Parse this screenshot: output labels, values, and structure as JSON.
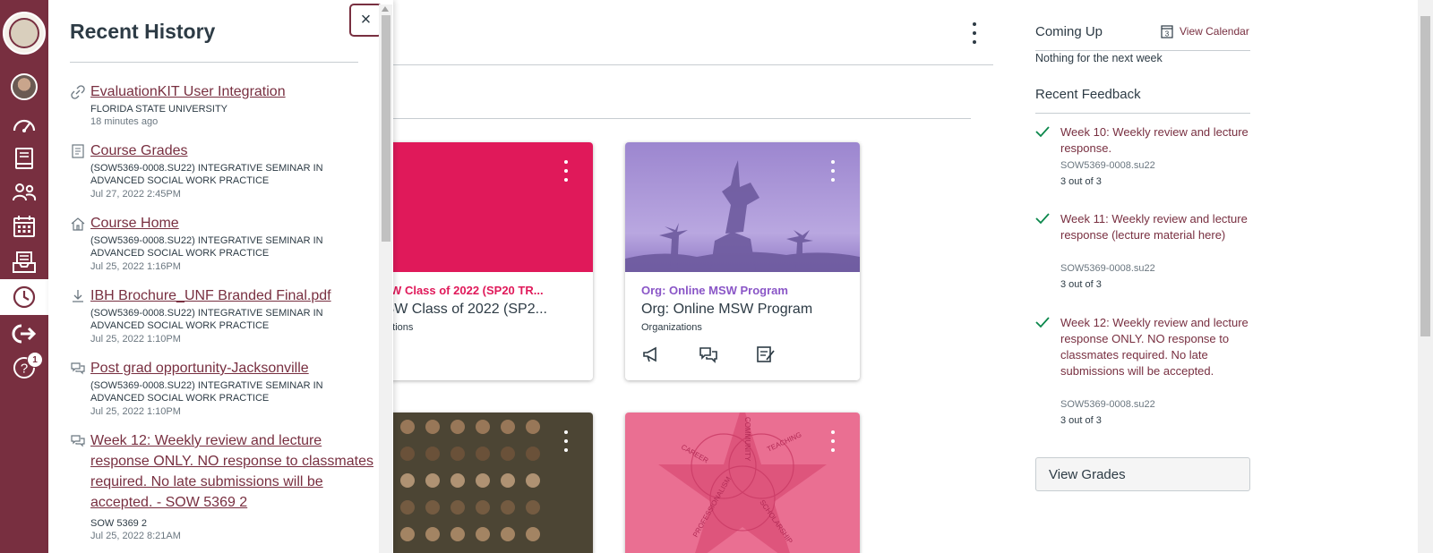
{
  "colors": {
    "brand": "#782f40",
    "card_pink": "#e0195a",
    "card_purple": "#a98fd6",
    "card_link_purple": "#8a56c7",
    "check_green": "#0b874b"
  },
  "nav": {
    "items": [
      {
        "name": "logo",
        "icon": "university-seal"
      },
      {
        "name": "account",
        "icon": "avatar"
      },
      {
        "name": "dashboard",
        "icon": "dashboard-icon"
      },
      {
        "name": "courses",
        "icon": "book-icon"
      },
      {
        "name": "groups",
        "icon": "groups-icon"
      },
      {
        "name": "calendar",
        "icon": "calendar-icon"
      },
      {
        "name": "inbox",
        "icon": "inbox-icon"
      },
      {
        "name": "history",
        "icon": "clock-icon",
        "active": true
      },
      {
        "name": "logout",
        "icon": "logout-icon"
      },
      {
        "name": "help",
        "icon": "help-icon"
      }
    ],
    "help_badge": "1"
  },
  "tray": {
    "title": "Recent History",
    "close_label": "×",
    "items": [
      {
        "icon": "link-icon",
        "title": "EvaluationKIT User Integration",
        "context": "FLORIDA STATE UNIVERSITY",
        "time": "18 minutes ago"
      },
      {
        "icon": "grades-icon",
        "title": "Course Grades",
        "context": "(SOW5369-0008.SU22) INTEGRATIVE SEMINAR IN ADVANCED SOCIAL WORK PRACTICE",
        "time": "Jul 27, 2022 2:45PM"
      },
      {
        "icon": "home-icon",
        "title": "Course Home",
        "context": "(SOW5369-0008.SU22) INTEGRATIVE SEMINAR IN ADVANCED SOCIAL WORK PRACTICE",
        "time": "Jul 25, 2022 1:16PM"
      },
      {
        "icon": "download-icon",
        "title": "IBH Brochure_UNF Branded Final.pdf",
        "context": "(SOW5369-0008.SU22) INTEGRATIVE SEMINAR IN ADVANCED SOCIAL WORK PRACTICE",
        "time": "Jul 25, 2022 1:10PM"
      },
      {
        "icon": "discussion-icon",
        "title": "Post grad opportunity-Jacksonville",
        "context": "(SOW5369-0008.SU22) INTEGRATIVE SEMINAR IN ADVANCED SOCIAL WORK PRACTICE",
        "time": "Jul 25, 2022 1:10PM"
      },
      {
        "icon": "discussion-icon",
        "title": "Week 12: Weekly review and lecture response ONLY. NO response to classmates required. No late submissions will be accepted. - SOW 5369 2",
        "context": "SOW 5369 2",
        "time": "Jul 25, 2022 8:21AM"
      }
    ]
  },
  "cards": [
    {
      "code": "CSW Class of 2022 (SP20 TR...",
      "name": "CSW Class of 2022 (SP2...",
      "term": "Organizations",
      "term_visible": "nizations"
    },
    {
      "code": "Org: Online MSW Program",
      "name": "Org: Online MSW Program",
      "term": "Organizations"
    }
  ],
  "sidebar": {
    "coming_up": "Coming Up",
    "view_calendar": "View Calendar",
    "calendar_day": "3",
    "nothing": "Nothing for the next week",
    "recent_feedback": "Recent Feedback",
    "feedback": [
      {
        "title": "Week 10: Weekly review and lecture response.",
        "course": "SOW5369-0008.su22",
        "score": "3 out of 3"
      },
      {
        "title": "Week 11: Weekly review and lecture response (lecture material here)",
        "course": "SOW5369-0008.su22",
        "score": "3 out of 3"
      },
      {
        "title": "Week 12: Weekly review and lecture response ONLY. NO response to classmates required. No late submissions will be accepted.",
        "course": "SOW5369-0008.su22",
        "score": "3 out of 3"
      }
    ],
    "view_grades": "View Grades"
  },
  "card_hero_labels": {
    "card4_words": [
      "CAREER",
      "TEACHING",
      "PROFESSIONALISM",
      "SCHOLARSHIP",
      "COMMUNITY"
    ]
  }
}
